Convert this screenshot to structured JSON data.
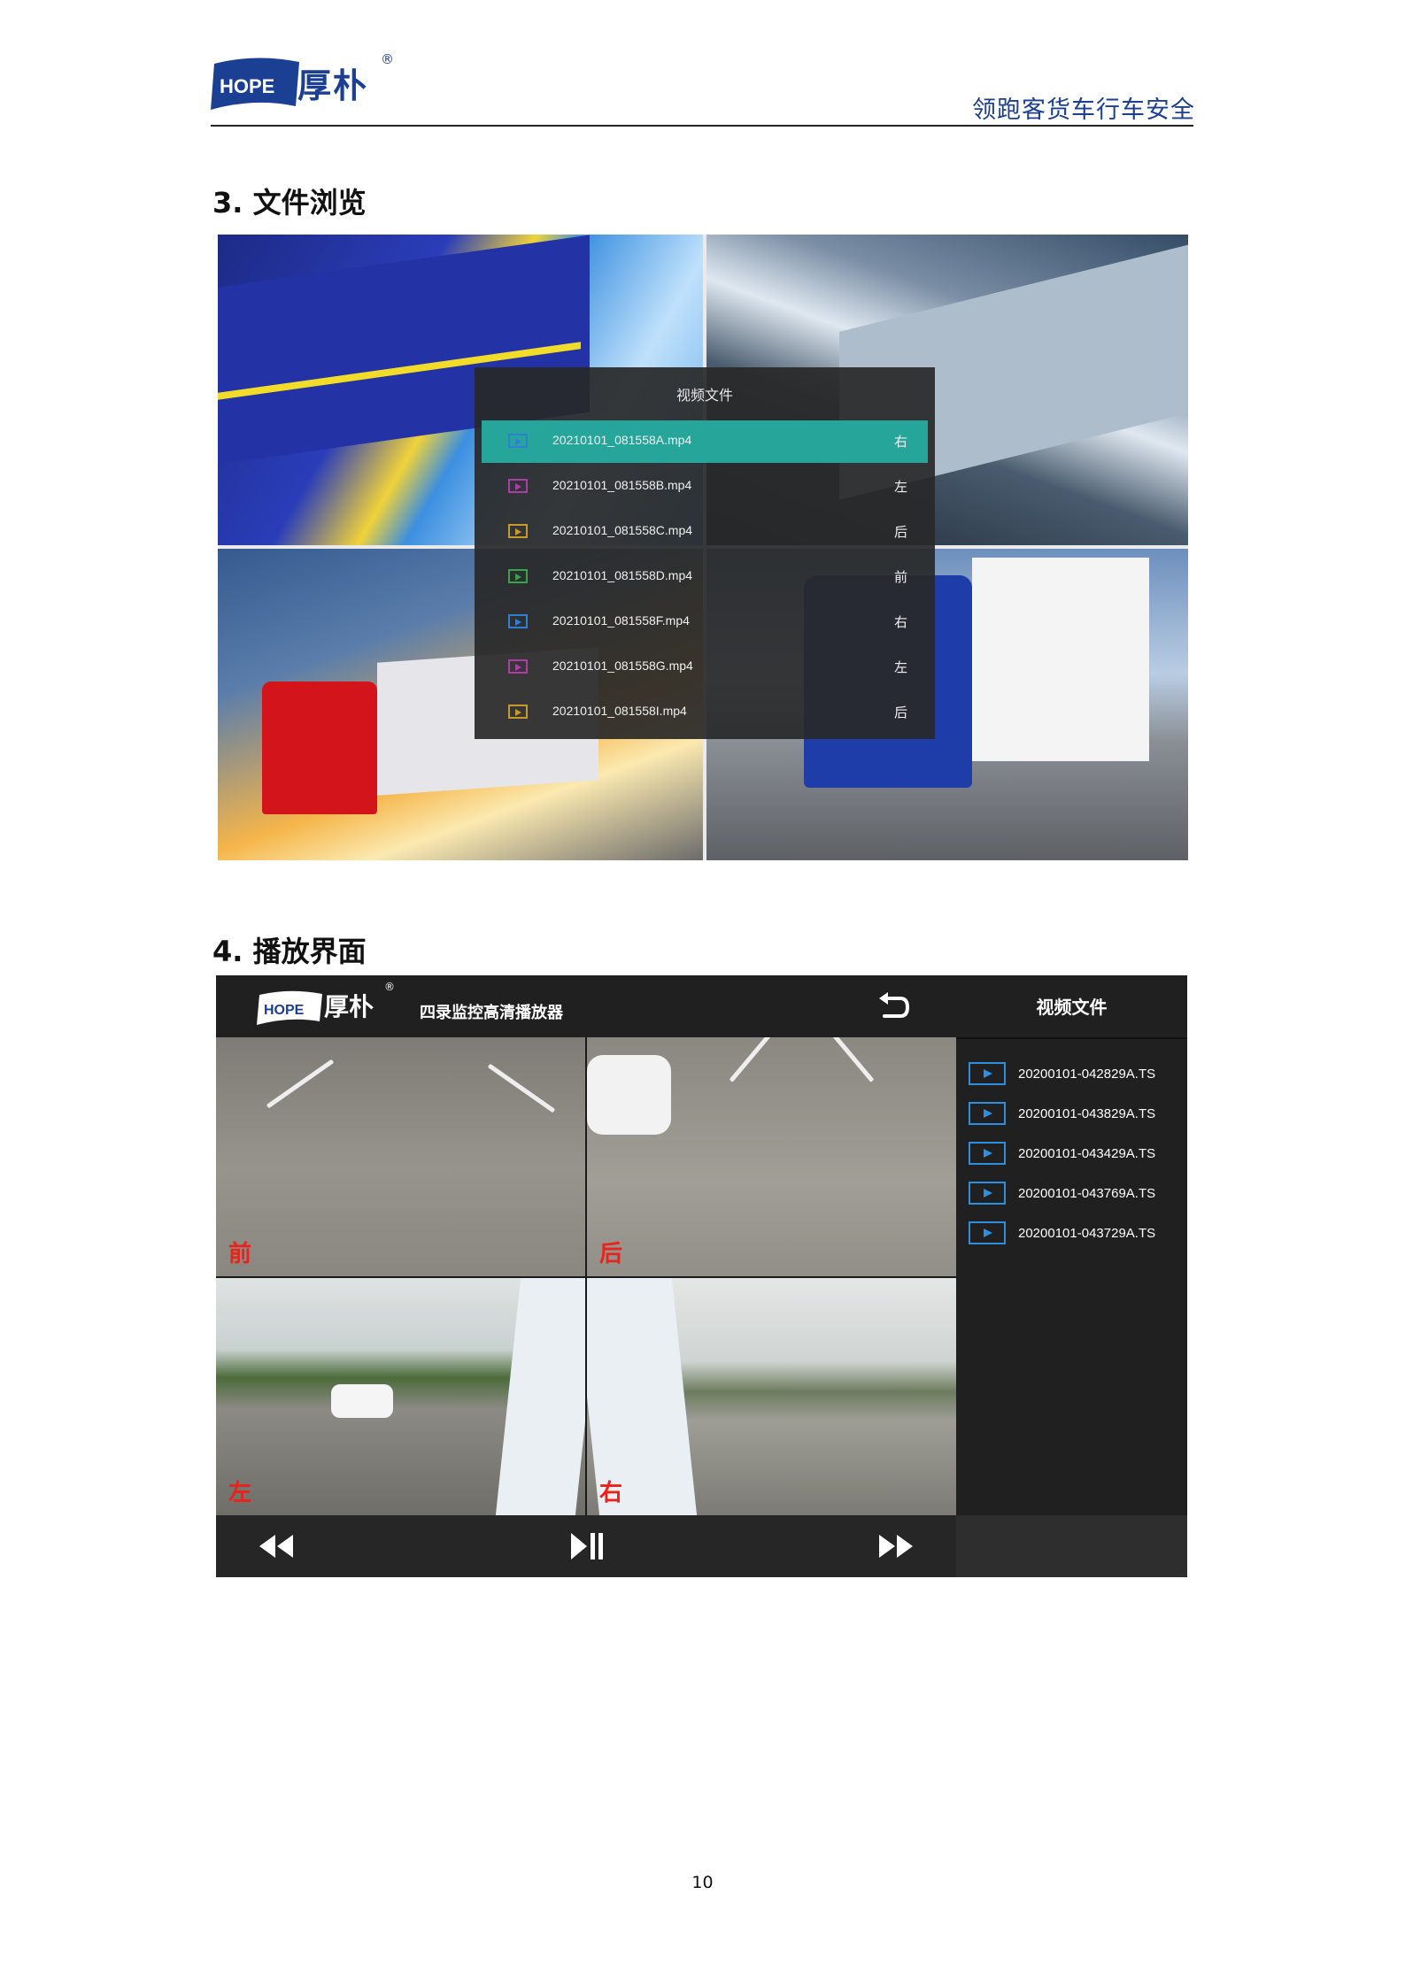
{
  "header": {
    "logo_en": "HOPE",
    "logo_cn": "厚朴",
    "registered": "®",
    "slogan": "领跑客货车行车安全",
    "brand_color": "#1b3f93"
  },
  "sections": [
    {
      "title": "3. 文件浏览"
    },
    {
      "title": "4. 播放界面"
    }
  ],
  "file_browser": {
    "dialog_title": "视频文件",
    "highlight_color": "#26a69a",
    "files": [
      {
        "name": "20210101_081558A.mp4",
        "position": "右",
        "icon_color": "#2f7fd6"
      },
      {
        "name": "20210101_081558B.mp4",
        "position": "左",
        "icon_color": "#b03aa8"
      },
      {
        "name": "20210101_081558C.mp4",
        "position": "后",
        "icon_color": "#c79a2a"
      },
      {
        "name": "20210101_081558D.mp4",
        "position": "前",
        "icon_color": "#3aa34a"
      },
      {
        "name": "20210101_081558F.mp4",
        "position": "右",
        "icon_color": "#2f7fd6"
      },
      {
        "name": "20210101_081558G.mp4",
        "position": "左",
        "icon_color": "#b03aa8"
      },
      {
        "name": "20210101_081558I.mp4",
        "position": "后",
        "icon_color": "#c79a2a"
      }
    ]
  },
  "player": {
    "logo_en": "HOPE",
    "logo_cn": "厚朴",
    "registered": "®",
    "title": "四录监控高清播放器",
    "list_title": "视频文件",
    "files": [
      "20200101-042829A.TS",
      "20200101-043829A.TS",
      "20200101-043429A.TS",
      "20200101-043769A.TS",
      "20200101-043729A.TS"
    ],
    "camera_labels": {
      "front": "前",
      "rear": "后",
      "left": "左",
      "right": "右"
    },
    "label_color": "#e8231c"
  },
  "footer": {
    "page_number": "10"
  }
}
